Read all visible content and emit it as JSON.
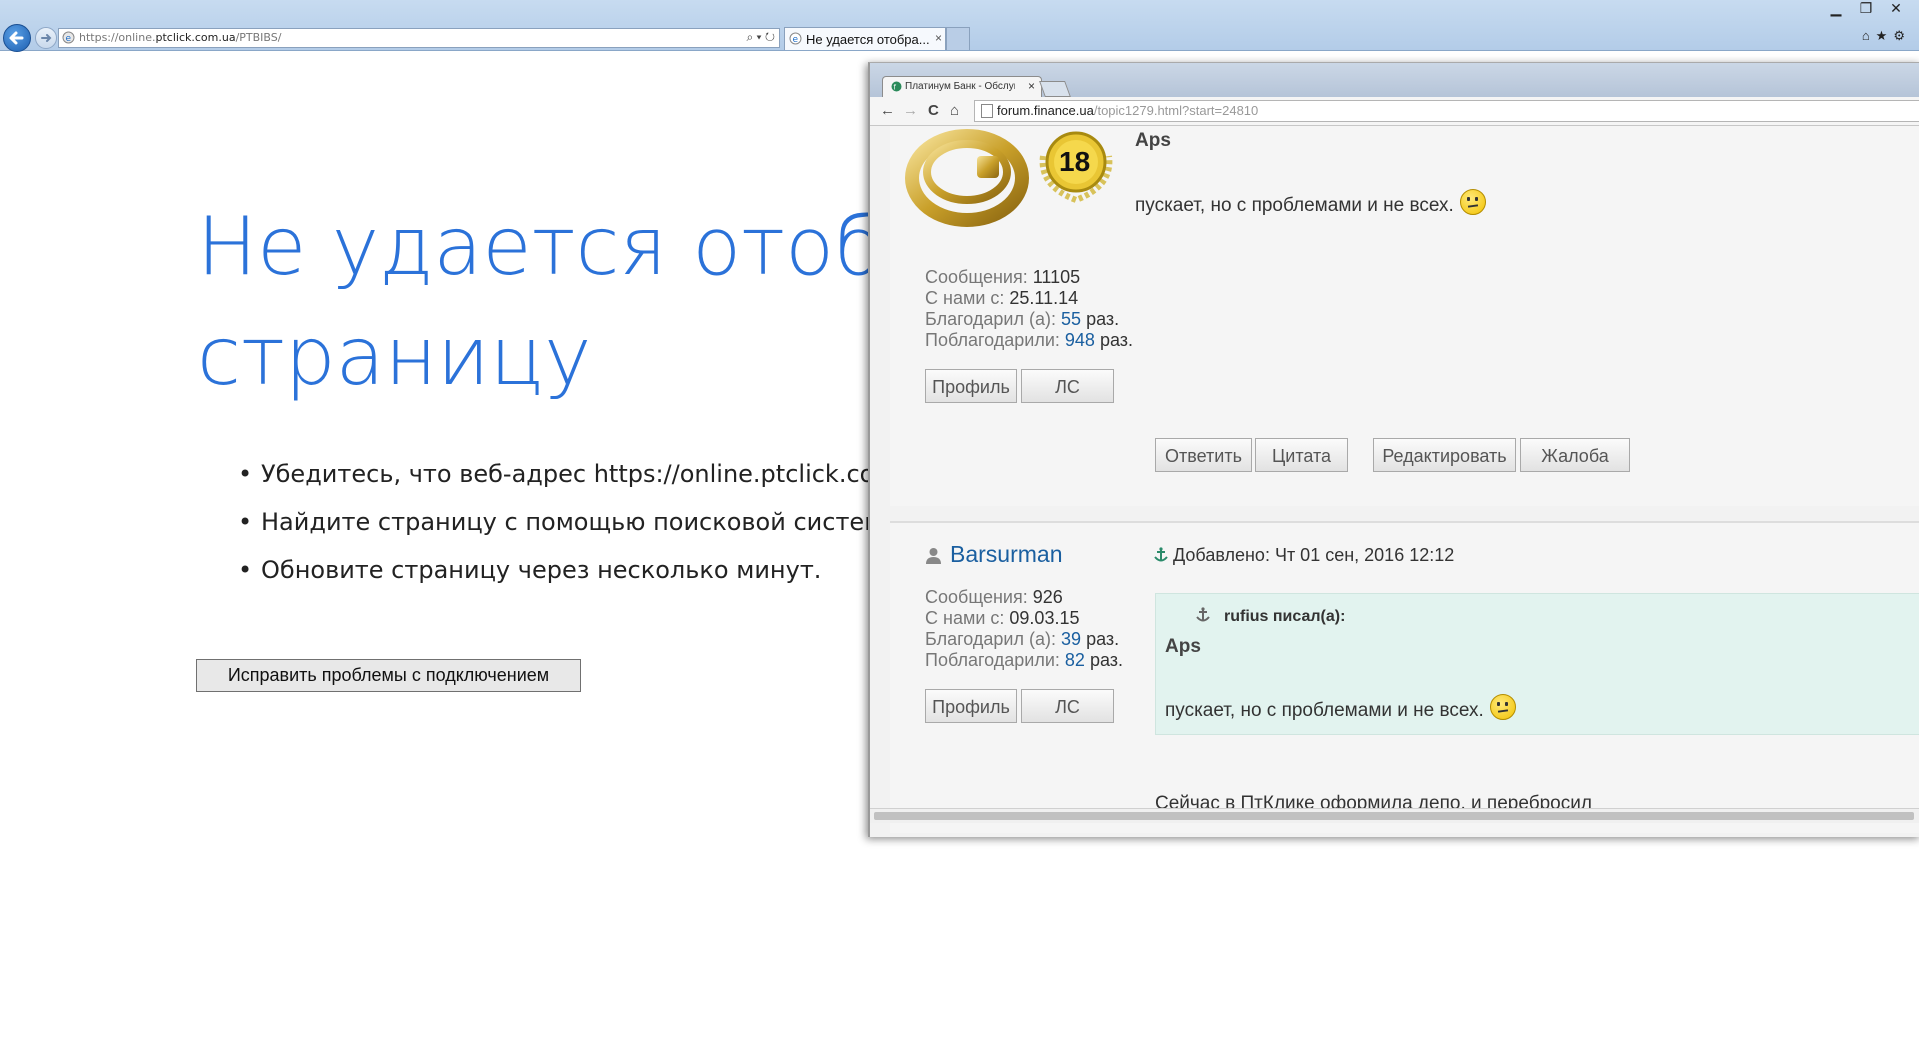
{
  "ie": {
    "address_prefix": "https://online.",
    "address_domain": "ptclick.com.ua",
    "address_suffix": "/PTBIBS/",
    "address_tools": "⌕ ▾ ↻",
    "tab_title": "Не удается отобра...",
    "tab_close": "×",
    "win_min": "▁",
    "win_max": "❐",
    "win_close": "✕",
    "right_tools": "⌂★⚙"
  },
  "error_page": {
    "title_line1": "Не удается отобра",
    "title_line2": "страницу",
    "bullets": [
      "Убедитесь, что веб-адрес https://online.ptclick.com.ua",
      "Найдите страницу с помощью поисковой системы.",
      "Обновите страницу через несколько минут."
    ],
    "fix_button": "Исправить проблемы с подключением"
  },
  "chrome": {
    "tab_title": "Платинум Банк - Обслуг",
    "tab_close": "×",
    "url_domain": "forum.finance.ua",
    "url_path": "/topic1279.html?start=24810",
    "nav_back": "←",
    "nav_forward": "→",
    "nav_reload": "C",
    "nav_home": "⌂"
  },
  "post1": {
    "badge_number": "18",
    "author": "Aps",
    "message": "пускает, но с проблемами и не всех.",
    "stats": {
      "posts_label": "Сообщения:",
      "posts_value": "11105",
      "since_label": "С нами с:",
      "since_value": "25.11.14",
      "thanked_label": "Благодарил (а):",
      "thanked_value": "55",
      "thanked_suffix": "раз.",
      "was_thanked_label": "Поблагодарили:",
      "was_thanked_value": "948",
      "was_thanked_suffix": "раз."
    },
    "btn_profile": "Профиль",
    "btn_pm": "ЛС",
    "btn_reply": "Ответить",
    "btn_quote": "Цитата",
    "btn_edit": "Редактировать",
    "btn_report": "Жалоба"
  },
  "post2": {
    "username": "Barsurman",
    "added": "Добавлено: Чт 01 сен, 2016 12:12",
    "stats": {
      "posts_label": "Сообщения:",
      "posts_value": "926",
      "since_label": "С нами с:",
      "since_value": "09.03.15",
      "thanked_label": "Благодарил (а):",
      "thanked_value": "39",
      "thanked_suffix": "раз.",
      "was_thanked_label": "Поблагодарили:",
      "was_thanked_value": "82",
      "was_thanked_suffix": "раз."
    },
    "btn_profile": "Профиль",
    "btn_pm": "ЛС",
    "quote_header": "rufius писал(а):",
    "quote_author": "Aps",
    "quote_message": "пускает, но с проблемами и не всех.",
    "message_tail": "Сейчас в ПтКлике оформила депо, и перебросил"
  },
  "colors": {
    "error_title": "#2b72d9",
    "link": "#1a5fa0",
    "quote_bg": "#e2f3ef"
  }
}
